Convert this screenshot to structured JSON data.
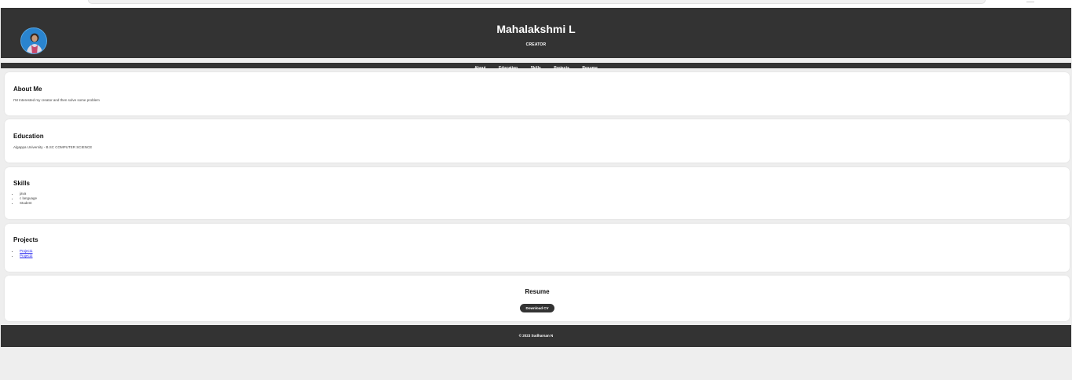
{
  "header": {
    "name": "Mahalakshmi L",
    "role": "CREATOR"
  },
  "nav": {
    "items": [
      "About",
      "Education",
      "Skills",
      "Projects",
      "Resume"
    ]
  },
  "about": {
    "title": "About Me",
    "text": "I'M Interested my creator and then solve some problem"
  },
  "education": {
    "title": "Education",
    "text": "Algappa University - B.SC COMPUTER SCIENCE"
  },
  "skills": {
    "title": "Skills",
    "items": [
      "java",
      "c language",
      "Student"
    ]
  },
  "projects": {
    "title": "Projects",
    "items": [
      "Project1",
      "Project2"
    ]
  },
  "resume": {
    "title": "Resume",
    "button_label": "Download CV"
  },
  "footer": {
    "text": "© 2023 Sudharsan N"
  },
  "colors": {
    "header_bg": "#333333",
    "page_bg": "#eeeeee",
    "card_bg": "#ffffff",
    "link": "#1a1aee"
  }
}
